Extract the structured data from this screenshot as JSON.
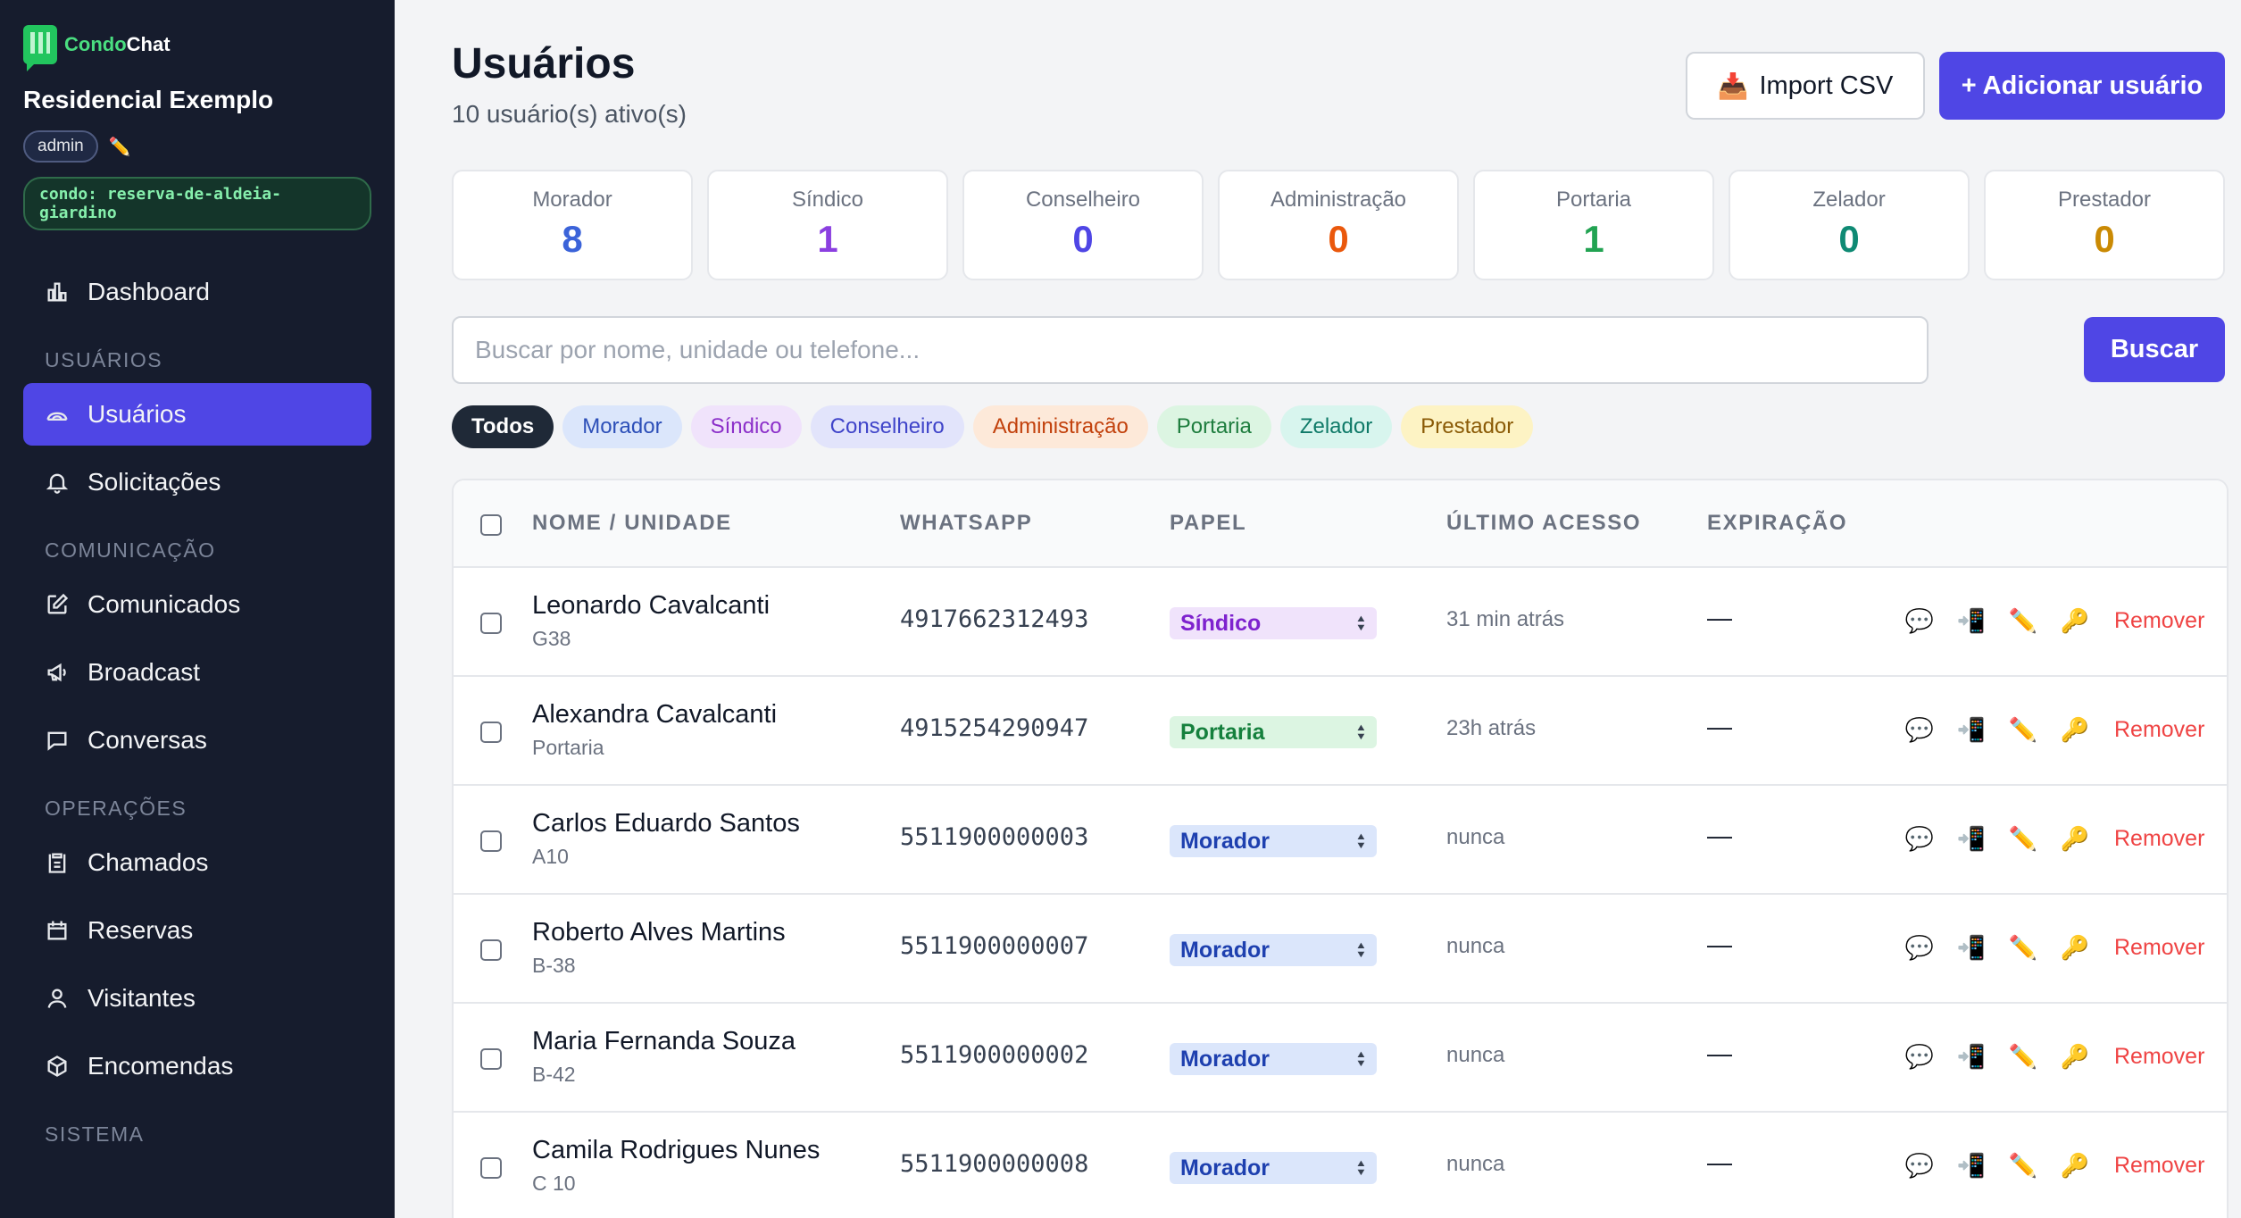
{
  "sidebar": {
    "brand_part1": "Condo",
    "brand_part2": "Chat",
    "org_name": "Residencial Exemplo",
    "role_badge": "admin",
    "condo_badge": "condo: reserva-de-aldeia-giardino",
    "dashboard": "Dashboard",
    "sections": {
      "usuarios": "USUÁRIOS",
      "comunicacao": "COMUNICAÇÃO",
      "operacoes": "OPERAÇÕES",
      "sistema": "SISTEMA"
    },
    "items": {
      "usuarios": "Usuários",
      "solicitacoes": "Solicitações",
      "comunicados": "Comunicados",
      "broadcast": "Broadcast",
      "conversas": "Conversas",
      "chamados": "Chamados",
      "reservas": "Reservas",
      "visitantes": "Visitantes",
      "encomendas": "Encomendas"
    }
  },
  "header": {
    "title": "Usuários",
    "subtitle": "10 usuário(s) ativo(s)",
    "import_label": "Import CSV",
    "add_label": "+ Adicionar usuário"
  },
  "stats": [
    {
      "label": "Morador",
      "value": "8",
      "color": "#3b63d9"
    },
    {
      "label": "Síndico",
      "value": "1",
      "color": "#8b3fe0"
    },
    {
      "label": "Conselheiro",
      "value": "0",
      "color": "#4f46e5"
    },
    {
      "label": "Administração",
      "value": "0",
      "color": "#ea580c"
    },
    {
      "label": "Portaria",
      "value": "1",
      "color": "#22a352"
    },
    {
      "label": "Zelador",
      "value": "0",
      "color": "#0f8a74"
    },
    {
      "label": "Prestador",
      "value": "0",
      "color": "#ca8a04"
    }
  ],
  "search": {
    "placeholder": "Buscar por nome, unidade ou telefone...",
    "button": "Buscar"
  },
  "filters": [
    {
      "label": "Todos",
      "bg": "#1f2937",
      "fg": "#ffffff"
    },
    {
      "label": "Morador",
      "bg": "#dbe6fb",
      "fg": "#2c4fb8"
    },
    {
      "label": "Síndico",
      "bg": "#f0e3fb",
      "fg": "#8b2fc9"
    },
    {
      "label": "Conselheiro",
      "bg": "#e2e4fb",
      "fg": "#3f44c9"
    },
    {
      "label": "Administração",
      "bg": "#fde9d9",
      "fg": "#c2410c"
    },
    {
      "label": "Portaria",
      "bg": "#dcf5e2",
      "fg": "#1e7d3e"
    },
    {
      "label": "Zelador",
      "bg": "#d8f5ee",
      "fg": "#0f7a68"
    },
    {
      "label": "Prestador",
      "bg": "#fdf3c4",
      "fg": "#8a5a06"
    }
  ],
  "table": {
    "headers": {
      "name": "NOME / UNIDADE",
      "whatsapp": "WHATSAPP",
      "role": "PAPEL",
      "last_access": "ÚLTIMO ACESSO",
      "expiration": "EXPIRAÇÃO"
    },
    "remove_label": "Remover",
    "rows": [
      {
        "name": "Leonardo Cavalcanti",
        "unit": "G38",
        "phone": "4917662312493",
        "role": "Síndico",
        "role_bg": "#f0e3fb",
        "role_fg": "#7e22ce",
        "last_access": "31 min atrás",
        "expiration": "—"
      },
      {
        "name": "Alexandra Cavalcanti",
        "unit": "Portaria",
        "phone": "4915254290947",
        "role": "Portaria",
        "role_bg": "#dcf5e2",
        "role_fg": "#15803d",
        "last_access": "23h atrás",
        "expiration": "—"
      },
      {
        "name": "Carlos Eduardo Santos",
        "unit": "A10",
        "phone": "5511900000003",
        "role": "Morador",
        "role_bg": "#dbe6fb",
        "role_fg": "#1e40af",
        "last_access": "nunca",
        "expiration": "—"
      },
      {
        "name": "Roberto Alves Martins",
        "unit": "B-38",
        "phone": "5511900000007",
        "role": "Morador",
        "role_bg": "#dbe6fb",
        "role_fg": "#1e40af",
        "last_access": "nunca",
        "expiration": "—"
      },
      {
        "name": "Maria Fernanda Souza",
        "unit": "B-42",
        "phone": "5511900000002",
        "role": "Morador",
        "role_bg": "#dbe6fb",
        "role_fg": "#1e40af",
        "last_access": "nunca",
        "expiration": "—"
      },
      {
        "name": "Camila Rodrigues Nunes",
        "unit": "C 10",
        "phone": "5511900000008",
        "role": "Morador",
        "role_bg": "#dbe6fb",
        "role_fg": "#1e40af",
        "last_access": "nunca",
        "expiration": "—"
      }
    ]
  }
}
